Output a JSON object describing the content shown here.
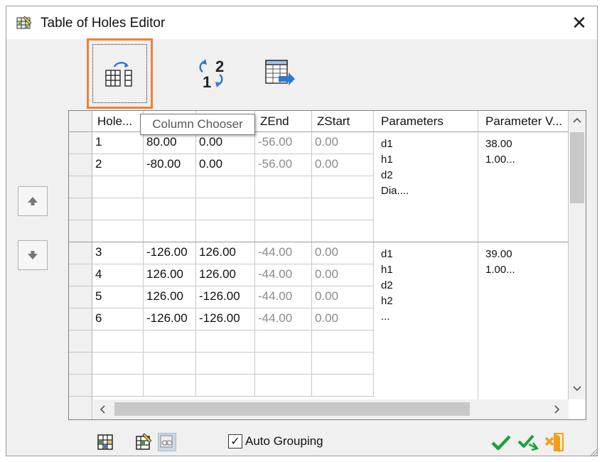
{
  "window": {
    "title": "Table of Holes Editor",
    "close_label": "✕"
  },
  "toolbar": {
    "column_chooser_icon": "column-chooser-icon",
    "renumber_icon": "renumber-icon",
    "export_icon": "export-table-icon",
    "renumber_digit_top": "2",
    "renumber_digit_bottom": "1"
  },
  "tooltip": {
    "text": "Column Chooser"
  },
  "grid": {
    "columns": [
      {
        "label": "Hole..."
      },
      {
        "label": ""
      },
      {
        "label": ""
      },
      {
        "label": "ZEnd"
      },
      {
        "label": "ZStart"
      },
      {
        "label": "Parameters"
      },
      {
        "label": "Parameter V..."
      }
    ],
    "group1": {
      "rows": [
        {
          "hole": "1",
          "x": "80.00",
          "y": "0.00",
          "zend": "-56.00",
          "zstart": "0.00"
        },
        {
          "hole": "2",
          "x": "-80.00",
          "y": "0.00",
          "zend": "-56.00",
          "zstart": "0.00"
        }
      ],
      "parameters": "d1\nh1\nd2\nDia....",
      "parameter_values": "38.00\n1.00..."
    },
    "group2": {
      "rows": [
        {
          "hole": "3",
          "x": "-126.00",
          "y": "126.00",
          "zend": "-44.00",
          "zstart": "0.00"
        },
        {
          "hole": "4",
          "x": "126.00",
          "y": "126.00",
          "zend": "-44.00",
          "zstart": "0.00"
        },
        {
          "hole": "5",
          "x": "126.00",
          "y": "-126.00",
          "zend": "-44.00",
          "zstart": "0.00"
        },
        {
          "hole": "6",
          "x": "-126.00",
          "y": "-126.00",
          "zend": "-44.00",
          "zstart": "0.00"
        }
      ],
      "parameters": "d1\nh1\nd2\nh2\n...",
      "parameter_values": "39.00\n1.00..."
    }
  },
  "bottom": {
    "auto_grouping_label": "Auto Grouping",
    "auto_grouping_checked": "✓"
  },
  "colors": {
    "highlight_border": "#e8843a",
    "ok_green": "#1aa23c",
    "cancel_orange": "#f0a020",
    "export_blue": "#2f78d0"
  }
}
